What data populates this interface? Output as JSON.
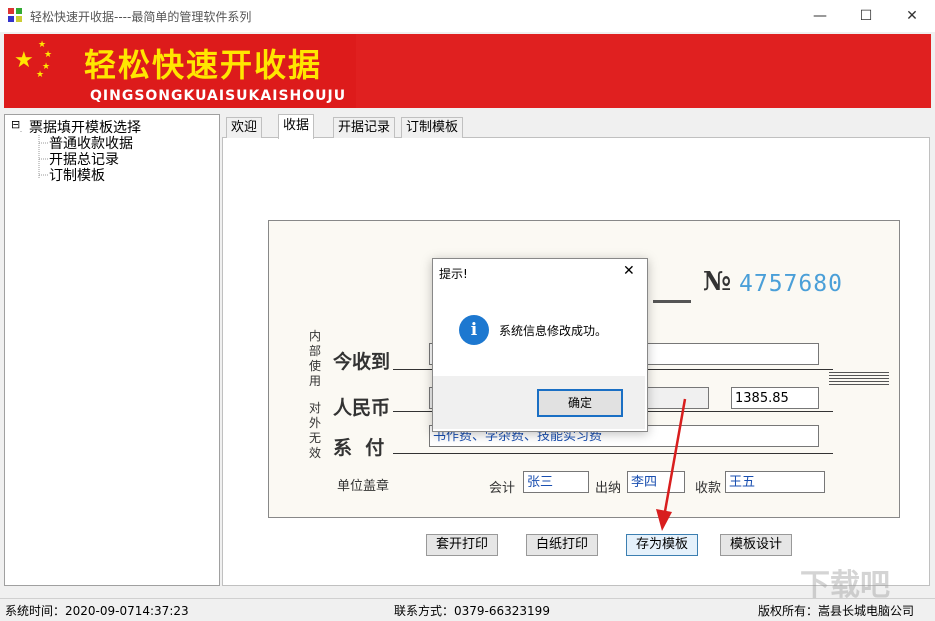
{
  "window": {
    "title": "轻松快速开收据----最简单的管理软件系列",
    "minimize": "—",
    "maximize": "☐",
    "close": "✕"
  },
  "banner": {
    "title": "轻松快速开收据",
    "subtitle": "QINGSONGKUAISUKAISHOUJU",
    "star": "★"
  },
  "tree": {
    "root_toggle": "⊟",
    "root": "票据填开模板选择",
    "children": [
      "普通收款收据",
      "开据总记录",
      "订制模板"
    ]
  },
  "tabs": [
    "欢迎",
    "收据",
    "开据记录",
    "订制模板"
  ],
  "receipt": {
    "number_prefix": "№",
    "number": "4757680",
    "side_left": "内部使用",
    "side_right": "对外无效",
    "received_label": "今收到",
    "rmb_label": "人民币",
    "reason_label": "系  付",
    "amount_value": "1385.85",
    "reason_value": "书作费、学杂费、技能实习费",
    "seal_label": "单位盖章",
    "accountant_label": "会计",
    "accountant_value": "张三",
    "cashier_label": "出纳",
    "cashier_value": "李四",
    "payee_label": "收款",
    "payee_value": "王五"
  },
  "buttons": {
    "print_preset": "套开打印",
    "print_blank": "白纸打印",
    "save_template": "存为模板",
    "design_template": "模板设计"
  },
  "dialog": {
    "title": "提示!",
    "close": "✕",
    "icon": "i",
    "message": "系统信息修改成功。",
    "ok": "确定"
  },
  "status": {
    "time": "系统时间：2020-09-0714:37:23",
    "contact": "联系方式：0379-66323199",
    "copyright": "版权所有：嵩县长城电脑公司"
  },
  "watermark": "下载吧",
  "colors": {
    "banner_red": "#dd1b1b",
    "banner_yellow": "#ffe600",
    "receipt_number": "#4a9fd8",
    "info_blue": "#1d78d0",
    "arrow_red": "#d81e1e"
  }
}
